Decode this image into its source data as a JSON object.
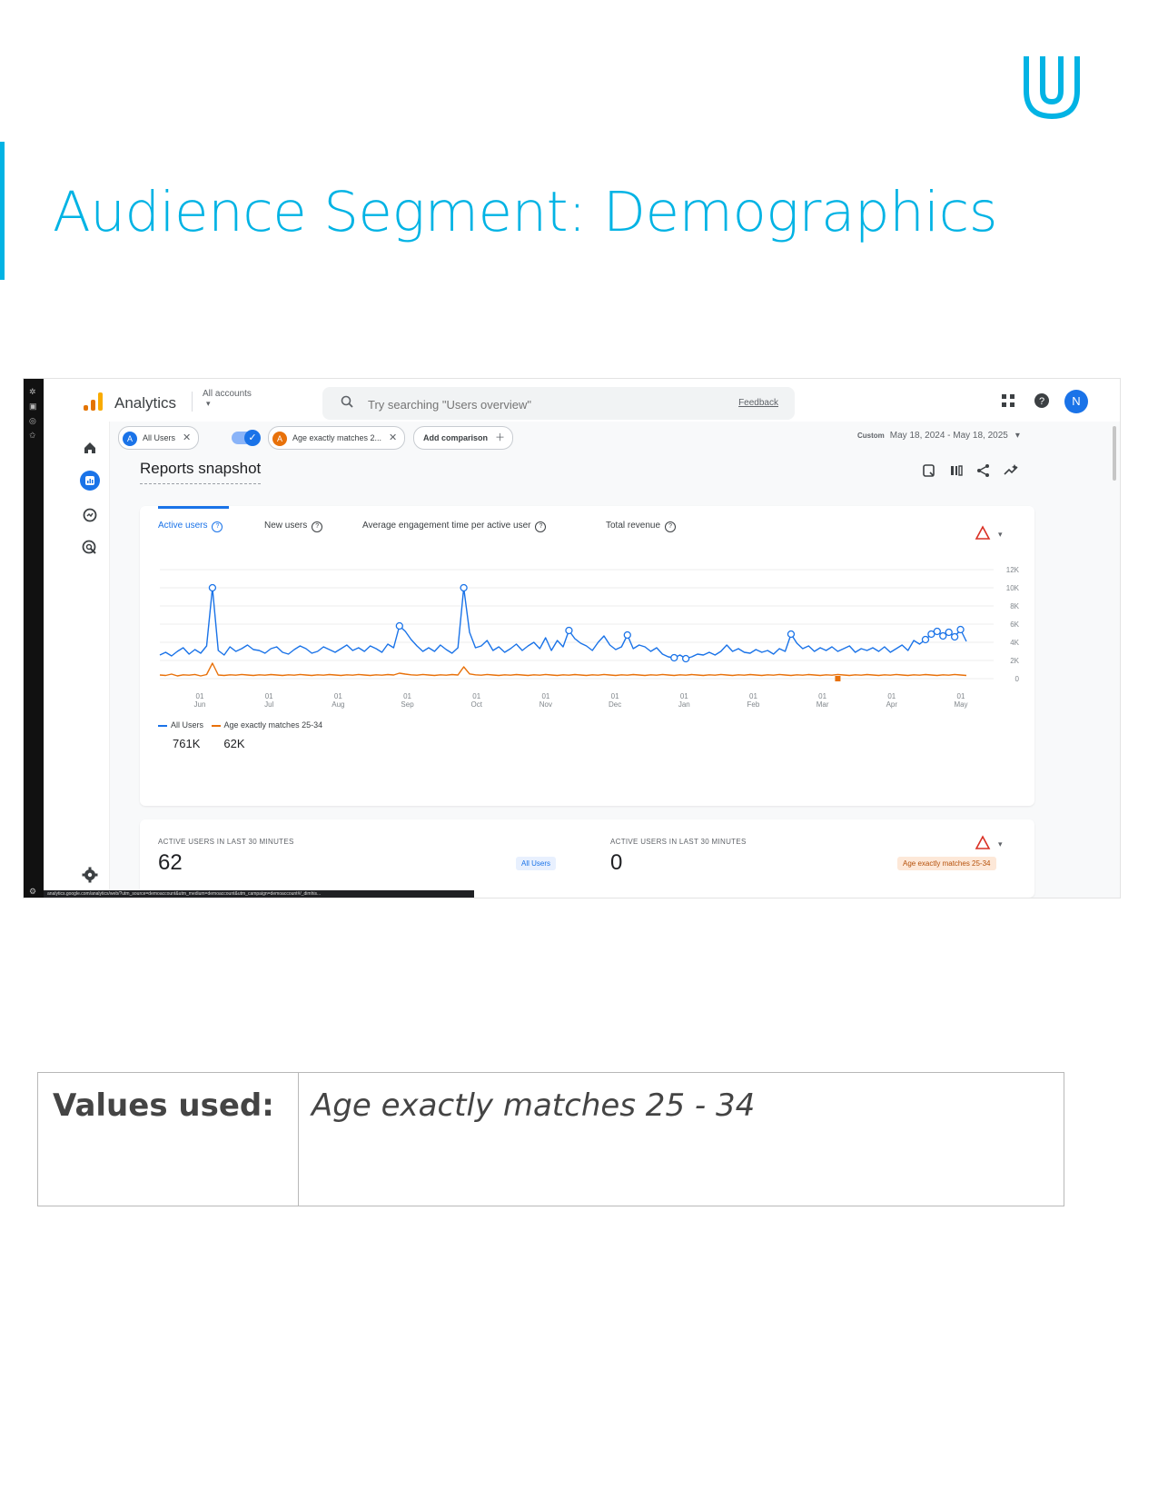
{
  "slide": {
    "title": "Audience Segment: Demographics",
    "accent_color": "#02b3e4",
    "logo_icon": "udacity-logo-icon"
  },
  "app": {
    "name": "Analytics",
    "account_picker": "All accounts",
    "search_placeholder": "Try searching \"Users overview\"",
    "feedback_label": "Feedback",
    "avatar_initial": "N"
  },
  "comparisons": {
    "segment_a": {
      "letter": "A",
      "label": "All Users",
      "color": "#1a73e8"
    },
    "segment_b": {
      "letter": "A",
      "label": "Age exactly matches 2...",
      "color": "#e8710a"
    },
    "add_label": "Add comparison"
  },
  "date_range": {
    "mode": "Custom",
    "value": "May 18, 2024 - May 18, 2025"
  },
  "page_title": "Reports snapshot",
  "tabs": [
    "Active users",
    "New users",
    "Average engagement time per active user",
    "Total revenue"
  ],
  "legend": {
    "series_a": "All Users",
    "series_b": "Age exactly matches 25-34"
  },
  "totals": {
    "series_a": "761K",
    "series_b": "62K"
  },
  "realtime": {
    "label_a": "ACTIVE USERS IN LAST 30 MINUTES",
    "value_a": "62",
    "segment_a": "All Users",
    "label_b": "ACTIVE USERS IN LAST 30 MINUTES",
    "value_b": "0",
    "segment_b": "Age exactly matches 25-34"
  },
  "status_url": "analytics.google.com/analytics/web/?utm_source=demoaccount&utm_medium=demoaccount&utm_campaign=demoaccount#/_dimhis...",
  "chart_data": {
    "type": "line",
    "x_ticks": [
      "01\nJun",
      "01\nJul",
      "01\nAug",
      "01\nSep",
      "01\nOct",
      "01\nNov",
      "01\nDec",
      "01\nJan",
      "01\nFeb",
      "01\nMar",
      "01\nApr",
      "01\nMay"
    ],
    "y_ticks": [
      "12K",
      "10K",
      "8K",
      "6K",
      "4K",
      "2K",
      "0"
    ],
    "ylim": [
      0,
      12000
    ],
    "grid": true,
    "series": [
      {
        "name": "All Users",
        "color": "#1a73e8",
        "values": [
          2600,
          2900,
          2500,
          3000,
          3400,
          2700,
          3200,
          2800,
          3600,
          10000,
          3100,
          2600,
          3500,
          3000,
          3300,
          3700,
          3200,
          3100,
          2800,
          3300,
          3500,
          2900,
          2700,
          3200,
          3600,
          3300,
          2800,
          3000,
          3500,
          3200,
          2900,
          3300,
          3700,
          3100,
          3400,
          3000,
          3600,
          3300,
          2900,
          3800,
          3400,
          5800,
          5200,
          4300,
          3600,
          3000,
          3400,
          3000,
          3700,
          3200,
          2800,
          3400,
          10000,
          5100,
          3400,
          3600,
          4200,
          3100,
          3500,
          2900,
          3300,
          3800,
          3100,
          3600,
          4000,
          3300,
          4500,
          3100,
          4200,
          3500,
          5300,
          4400,
          3900,
          3600,
          3100,
          4000,
          4700,
          3700,
          3200,
          3500,
          4800,
          3300,
          3700,
          3500,
          3000,
          3400,
          2700,
          2400,
          2300,
          2600,
          2200,
          2400,
          2700,
          2600,
          2900,
          2600,
          3000,
          3700,
          3000,
          3300,
          2900,
          2800,
          3200,
          2900,
          3100,
          2700,
          3300,
          3000,
          4900,
          3900,
          3300,
          3600,
          3000,
          3400,
          3100,
          3500,
          3000,
          3300,
          3600,
          2900,
          3300,
          3100,
          3400,
          3000,
          3500,
          2900,
          3300,
          3700,
          3100,
          4200,
          3800,
          4300,
          4900,
          5200,
          4700,
          5100,
          4600,
          5400,
          4100
        ],
        "peak_markers": "circles at local peaks and late-period rise"
      },
      {
        "name": "Age exactly matches 25-34",
        "color": "#e8710a",
        "values": [
          400,
          350,
          500,
          300,
          420,
          380,
          460,
          300,
          450,
          1700,
          400,
          350,
          420,
          380,
          460,
          400,
          350,
          420,
          380,
          450,
          400,
          350,
          420,
          380,
          460,
          400,
          350,
          420,
          380,
          450,
          400,
          350,
          420,
          380,
          460,
          400,
          350,
          420,
          380,
          450,
          400,
          600,
          500,
          420,
          380,
          460,
          400,
          350,
          420,
          380,
          450,
          400,
          1300,
          520,
          420,
          380,
          460,
          400,
          350,
          420,
          380,
          450,
          400,
          350,
          420,
          380,
          460,
          400,
          350,
          420,
          380,
          450,
          400,
          350,
          420,
          380,
          460,
          400,
          350,
          420,
          380,
          450,
          400,
          350,
          420,
          380,
          460,
          400,
          350,
          420,
          380,
          450,
          400,
          350,
          420,
          380,
          460,
          400,
          350,
          420,
          380,
          450,
          400,
          350,
          420,
          380,
          460,
          400,
          350,
          420,
          380,
          450,
          400,
          350,
          420,
          380,
          460,
          400,
          350,
          420,
          380,
          450,
          400,
          350,
          420,
          380,
          460,
          400,
          350,
          420,
          380,
          450,
          400,
          350,
          420,
          380,
          460,
          400,
          350
        ]
      }
    ],
    "anomaly_marker": {
      "series": "Age exactly matches 25-34",
      "x_index": 116,
      "value": 0,
      "color": "#e8710a"
    }
  },
  "table": {
    "key": "Values used:",
    "value": "Age exactly matches 25 - 34"
  }
}
